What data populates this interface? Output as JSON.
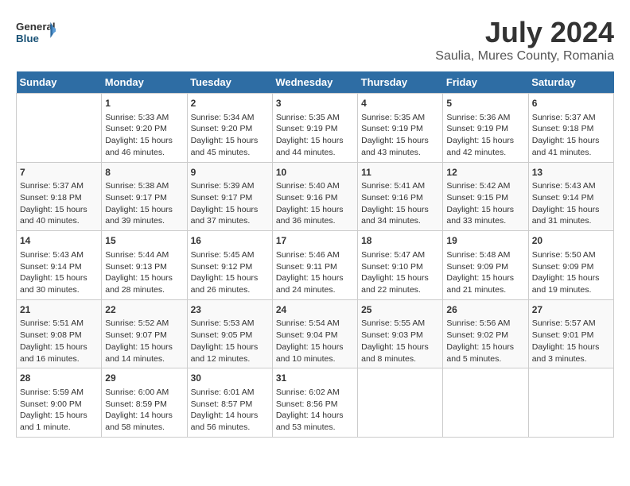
{
  "header": {
    "logo_general": "General",
    "logo_blue": "Blue",
    "month": "July 2024",
    "location": "Saulia, Mures County, Romania"
  },
  "days_of_week": [
    "Sunday",
    "Monday",
    "Tuesday",
    "Wednesday",
    "Thursday",
    "Friday",
    "Saturday"
  ],
  "weeks": [
    [
      {
        "day": "",
        "content": ""
      },
      {
        "day": "1",
        "sunrise": "Sunrise: 5:33 AM",
        "sunset": "Sunset: 9:20 PM",
        "daylight": "Daylight: 15 hours and 46 minutes."
      },
      {
        "day": "2",
        "sunrise": "Sunrise: 5:34 AM",
        "sunset": "Sunset: 9:20 PM",
        "daylight": "Daylight: 15 hours and 45 minutes."
      },
      {
        "day": "3",
        "sunrise": "Sunrise: 5:35 AM",
        "sunset": "Sunset: 9:19 PM",
        "daylight": "Daylight: 15 hours and 44 minutes."
      },
      {
        "day": "4",
        "sunrise": "Sunrise: 5:35 AM",
        "sunset": "Sunset: 9:19 PM",
        "daylight": "Daylight: 15 hours and 43 minutes."
      },
      {
        "day": "5",
        "sunrise": "Sunrise: 5:36 AM",
        "sunset": "Sunset: 9:19 PM",
        "daylight": "Daylight: 15 hours and 42 minutes."
      },
      {
        "day": "6",
        "sunrise": "Sunrise: 5:37 AM",
        "sunset": "Sunset: 9:18 PM",
        "daylight": "Daylight: 15 hours and 41 minutes."
      }
    ],
    [
      {
        "day": "7",
        "sunrise": "Sunrise: 5:37 AM",
        "sunset": "Sunset: 9:18 PM",
        "daylight": "Daylight: 15 hours and 40 minutes."
      },
      {
        "day": "8",
        "sunrise": "Sunrise: 5:38 AM",
        "sunset": "Sunset: 9:17 PM",
        "daylight": "Daylight: 15 hours and 39 minutes."
      },
      {
        "day": "9",
        "sunrise": "Sunrise: 5:39 AM",
        "sunset": "Sunset: 9:17 PM",
        "daylight": "Daylight: 15 hours and 37 minutes."
      },
      {
        "day": "10",
        "sunrise": "Sunrise: 5:40 AM",
        "sunset": "Sunset: 9:16 PM",
        "daylight": "Daylight: 15 hours and 36 minutes."
      },
      {
        "day": "11",
        "sunrise": "Sunrise: 5:41 AM",
        "sunset": "Sunset: 9:16 PM",
        "daylight": "Daylight: 15 hours and 34 minutes."
      },
      {
        "day": "12",
        "sunrise": "Sunrise: 5:42 AM",
        "sunset": "Sunset: 9:15 PM",
        "daylight": "Daylight: 15 hours and 33 minutes."
      },
      {
        "day": "13",
        "sunrise": "Sunrise: 5:43 AM",
        "sunset": "Sunset: 9:14 PM",
        "daylight": "Daylight: 15 hours and 31 minutes."
      }
    ],
    [
      {
        "day": "14",
        "sunrise": "Sunrise: 5:43 AM",
        "sunset": "Sunset: 9:14 PM",
        "daylight": "Daylight: 15 hours and 30 minutes."
      },
      {
        "day": "15",
        "sunrise": "Sunrise: 5:44 AM",
        "sunset": "Sunset: 9:13 PM",
        "daylight": "Daylight: 15 hours and 28 minutes."
      },
      {
        "day": "16",
        "sunrise": "Sunrise: 5:45 AM",
        "sunset": "Sunset: 9:12 PM",
        "daylight": "Daylight: 15 hours and 26 minutes."
      },
      {
        "day": "17",
        "sunrise": "Sunrise: 5:46 AM",
        "sunset": "Sunset: 9:11 PM",
        "daylight": "Daylight: 15 hours and 24 minutes."
      },
      {
        "day": "18",
        "sunrise": "Sunrise: 5:47 AM",
        "sunset": "Sunset: 9:10 PM",
        "daylight": "Daylight: 15 hours and 22 minutes."
      },
      {
        "day": "19",
        "sunrise": "Sunrise: 5:48 AM",
        "sunset": "Sunset: 9:09 PM",
        "daylight": "Daylight: 15 hours and 21 minutes."
      },
      {
        "day": "20",
        "sunrise": "Sunrise: 5:50 AM",
        "sunset": "Sunset: 9:09 PM",
        "daylight": "Daylight: 15 hours and 19 minutes."
      }
    ],
    [
      {
        "day": "21",
        "sunrise": "Sunrise: 5:51 AM",
        "sunset": "Sunset: 9:08 PM",
        "daylight": "Daylight: 15 hours and 16 minutes."
      },
      {
        "day": "22",
        "sunrise": "Sunrise: 5:52 AM",
        "sunset": "Sunset: 9:07 PM",
        "daylight": "Daylight: 15 hours and 14 minutes."
      },
      {
        "day": "23",
        "sunrise": "Sunrise: 5:53 AM",
        "sunset": "Sunset: 9:05 PM",
        "daylight": "Daylight: 15 hours and 12 minutes."
      },
      {
        "day": "24",
        "sunrise": "Sunrise: 5:54 AM",
        "sunset": "Sunset: 9:04 PM",
        "daylight": "Daylight: 15 hours and 10 minutes."
      },
      {
        "day": "25",
        "sunrise": "Sunrise: 5:55 AM",
        "sunset": "Sunset: 9:03 PM",
        "daylight": "Daylight: 15 hours and 8 minutes."
      },
      {
        "day": "26",
        "sunrise": "Sunrise: 5:56 AM",
        "sunset": "Sunset: 9:02 PM",
        "daylight": "Daylight: 15 hours and 5 minutes."
      },
      {
        "day": "27",
        "sunrise": "Sunrise: 5:57 AM",
        "sunset": "Sunset: 9:01 PM",
        "daylight": "Daylight: 15 hours and 3 minutes."
      }
    ],
    [
      {
        "day": "28",
        "sunrise": "Sunrise: 5:59 AM",
        "sunset": "Sunset: 9:00 PM",
        "daylight": "Daylight: 15 hours and 1 minute."
      },
      {
        "day": "29",
        "sunrise": "Sunrise: 6:00 AM",
        "sunset": "Sunset: 8:59 PM",
        "daylight": "Daylight: 14 hours and 58 minutes."
      },
      {
        "day": "30",
        "sunrise": "Sunrise: 6:01 AM",
        "sunset": "Sunset: 8:57 PM",
        "daylight": "Daylight: 14 hours and 56 minutes."
      },
      {
        "day": "31",
        "sunrise": "Sunrise: 6:02 AM",
        "sunset": "Sunset: 8:56 PM",
        "daylight": "Daylight: 14 hours and 53 minutes."
      },
      {
        "day": "",
        "content": ""
      },
      {
        "day": "",
        "content": ""
      },
      {
        "day": "",
        "content": ""
      }
    ]
  ]
}
